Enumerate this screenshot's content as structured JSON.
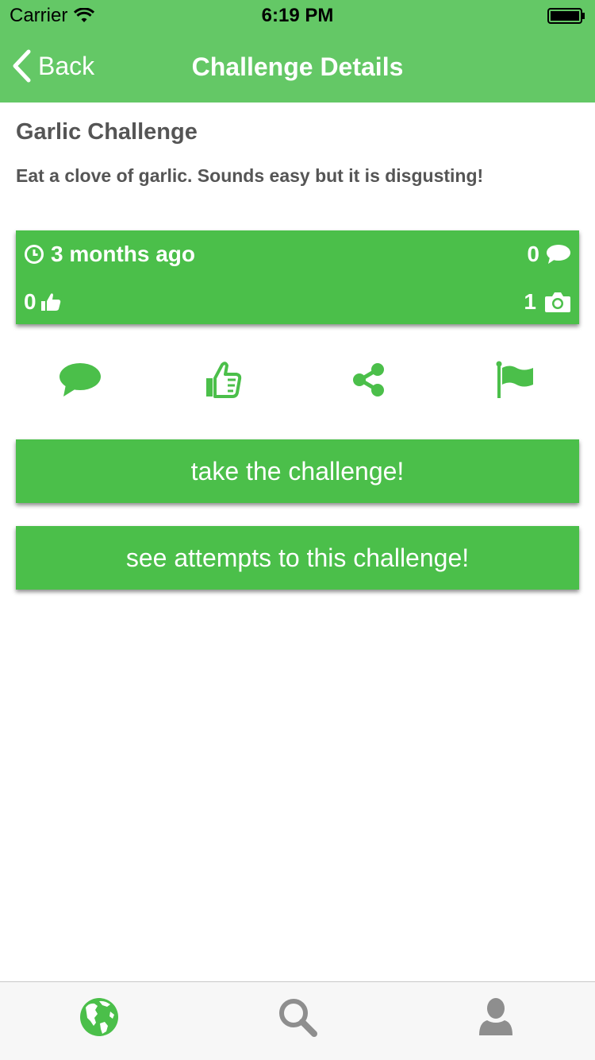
{
  "status_bar": {
    "carrier": "Carrier",
    "time": "6:19 PM"
  },
  "nav": {
    "back_label": "Back",
    "title": "Challenge Details"
  },
  "challenge": {
    "title": "Garlic Challenge",
    "description": "Eat a clove of garlic. Sounds easy but it is disgusting!"
  },
  "stats": {
    "posted": "3 months ago",
    "comments": "0",
    "likes": "0",
    "photos": "1"
  },
  "buttons": {
    "take_challenge": "take the challenge!",
    "see_attempts": "see attempts to this challenge!"
  },
  "action_icons": [
    "comment-icon",
    "thumbs-up-icon",
    "share-icon",
    "flag-icon"
  ],
  "tab_icons": [
    "globe-icon",
    "search-icon",
    "user-icon"
  ],
  "colors": {
    "nav_bar": "#64c866",
    "accent": "#4bbf4a",
    "text": "#555555",
    "tab_inactive": "#8e8e8e"
  }
}
